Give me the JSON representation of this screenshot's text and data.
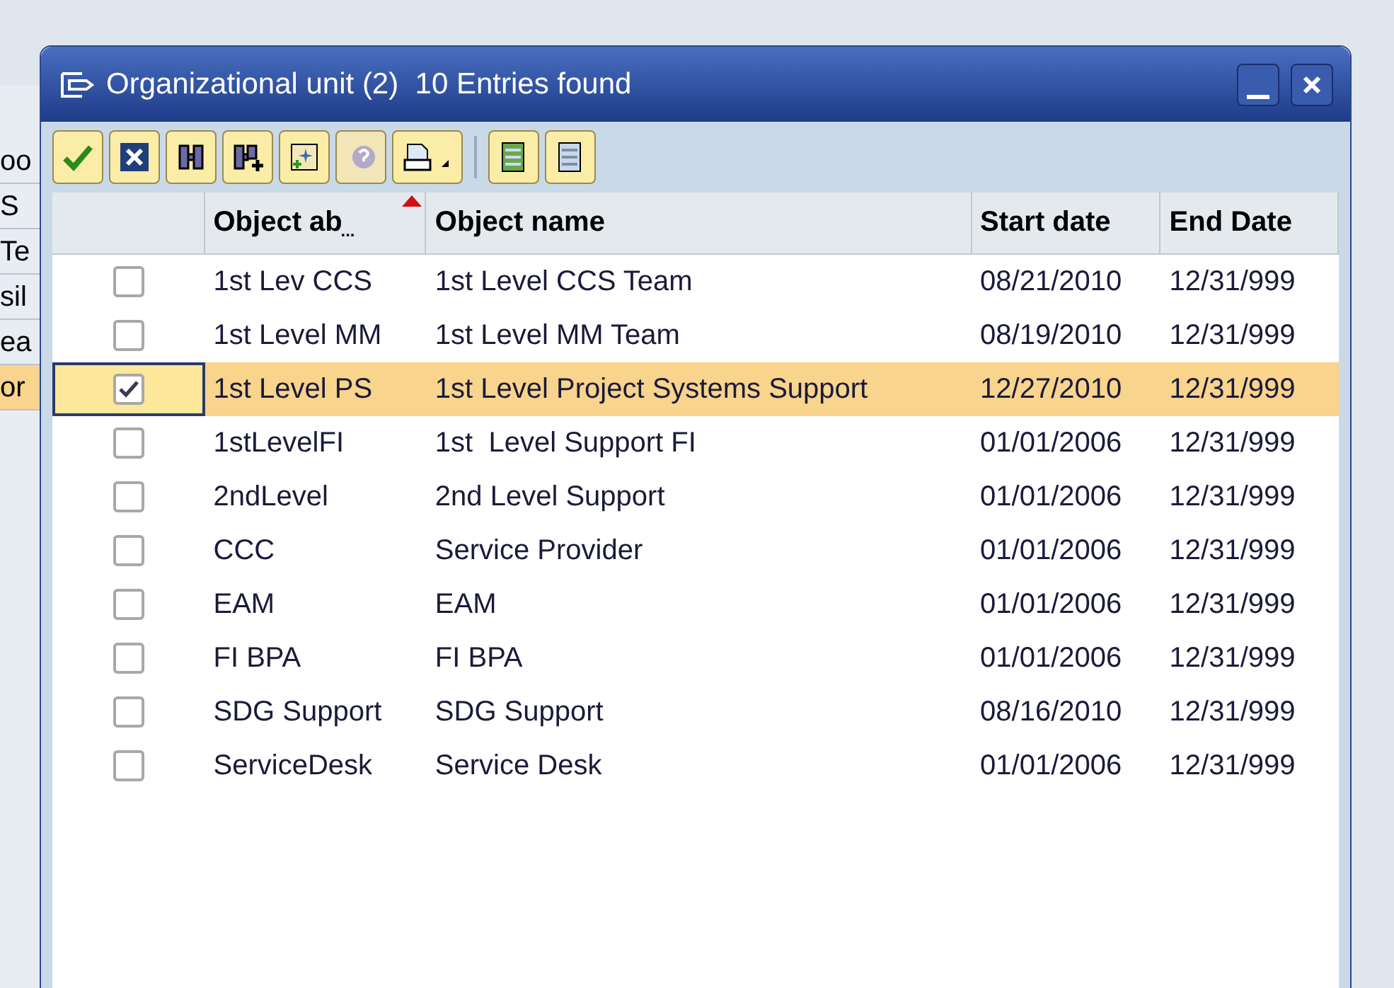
{
  "background": {
    "left_cells": [
      "oo",
      "S",
      "Te",
      "sil",
      "ea",
      "or"
    ]
  },
  "dialog": {
    "title": "Organizational unit (2)  10 Entries found"
  },
  "toolbar": [
    {
      "kind": "check"
    },
    {
      "kind": "cancel"
    },
    {
      "kind": "find"
    },
    {
      "kind": "findnext"
    },
    {
      "kind": "new"
    },
    {
      "kind": "help",
      "disabled": true
    },
    {
      "kind": "print"
    },
    {
      "kind": "list"
    },
    {
      "kind": "list2"
    }
  ],
  "table": {
    "columns": [
      "Object ab",
      "Object name",
      "Start date",
      "End Date"
    ],
    "sort_mark": "...",
    "rows": [
      {
        "abbr": "1st Lev CCS",
        "name": "1st Level CCS Team",
        "start": "08/21/2010",
        "end": "12/31/999",
        "checked": false,
        "selected": false
      },
      {
        "abbr": "1st Level MM",
        "name": "1st Level MM Team",
        "start": "08/19/2010",
        "end": "12/31/999",
        "checked": false,
        "selected": false
      },
      {
        "abbr": "1st Level PS",
        "name": "1st Level Project Systems Support",
        "start": "12/27/2010",
        "end": "12/31/999",
        "checked": true,
        "selected": true
      },
      {
        "abbr": "1stLevelFI",
        "name": "1st  Level Support FI",
        "start": "01/01/2006",
        "end": "12/31/999",
        "checked": false,
        "selected": false
      },
      {
        "abbr": "2ndLevel",
        "name": "2nd Level Support",
        "start": "01/01/2006",
        "end": "12/31/999",
        "checked": false,
        "selected": false
      },
      {
        "abbr": "CCC",
        "name": "Service Provider",
        "start": "01/01/2006",
        "end": "12/31/999",
        "checked": false,
        "selected": false
      },
      {
        "abbr": "EAM",
        "name": "EAM",
        "start": "01/01/2006",
        "end": "12/31/999",
        "checked": false,
        "selected": false
      },
      {
        "abbr": "FI BPA",
        "name": "FI BPA",
        "start": "01/01/2006",
        "end": "12/31/999",
        "checked": false,
        "selected": false
      },
      {
        "abbr": "SDG Support",
        "name": "SDG Support",
        "start": "08/16/2010",
        "end": "12/31/999",
        "checked": false,
        "selected": false
      },
      {
        "abbr": "ServiceDesk",
        "name": "Service Desk",
        "start": "01/01/2006",
        "end": "12/31/999",
        "checked": false,
        "selected": false
      }
    ]
  }
}
